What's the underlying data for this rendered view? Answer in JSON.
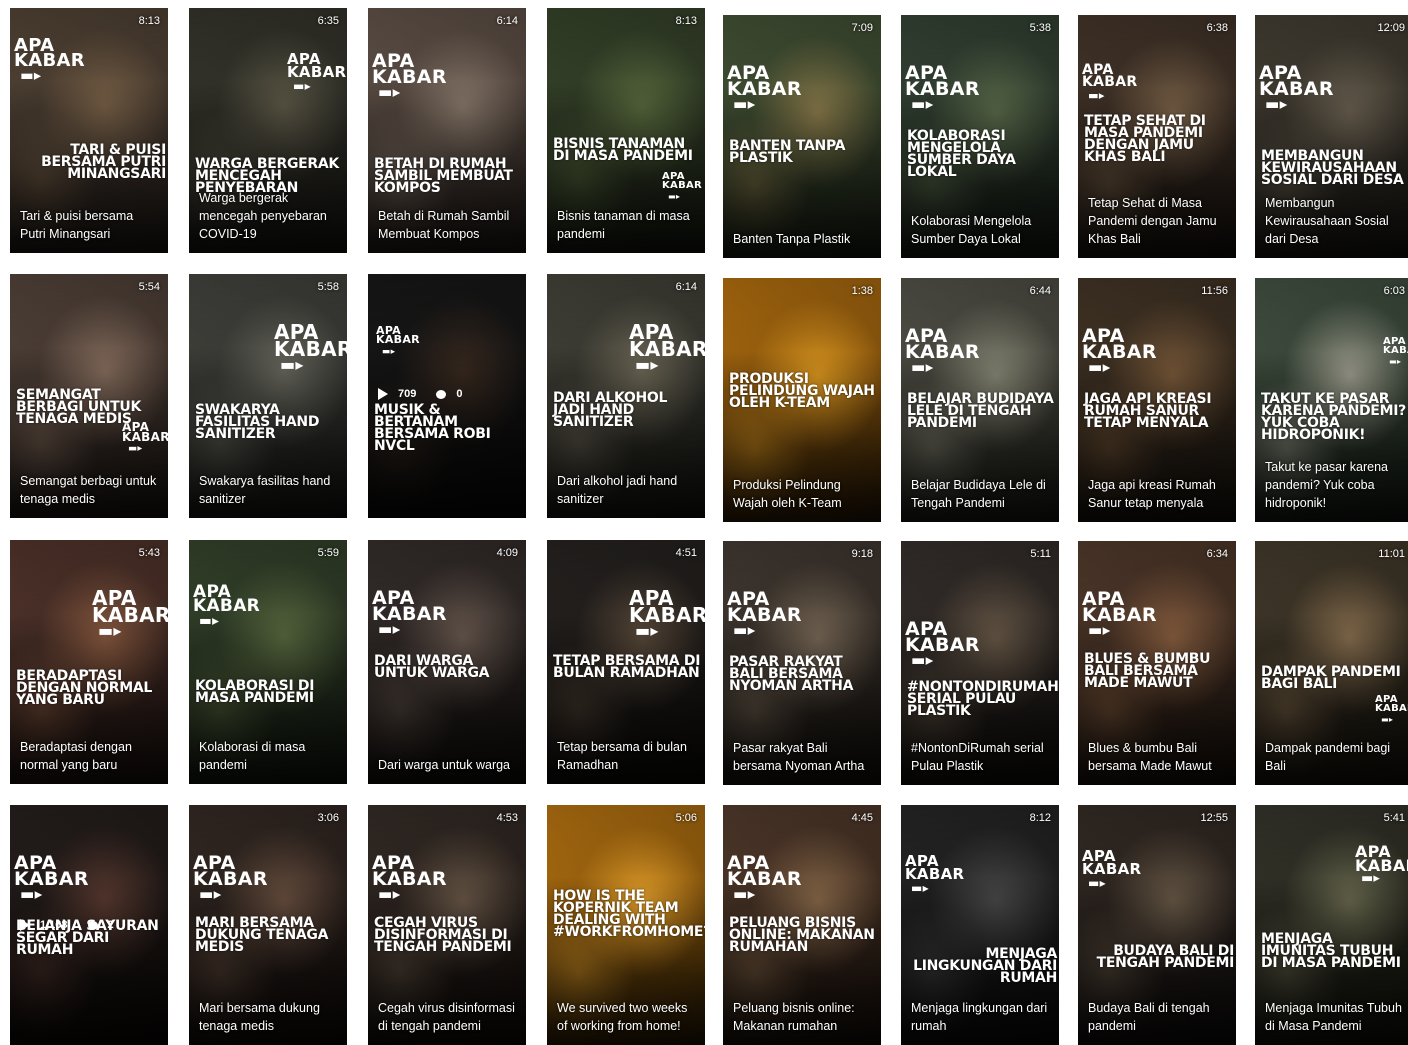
{
  "brand_logo": "APA KABAR",
  "brand_colors": {
    "orange": "#d88a10",
    "dark": "#1c1a18"
  },
  "videos": [
    {
      "duration": "8:13",
      "headline": "TARI & PUISI BERSAMA PUTRI MINANGSARI",
      "caption": "Tari & puisi bersama Putri Minangsari"
    },
    {
      "duration": "6:35",
      "headline": "WARGA BERGERAK MENCEGAH PENYEBARAN",
      "caption": "Warga bergerak mencegah penyebaran COVID-19"
    },
    {
      "duration": "6:14",
      "headline": "BETAH DI RUMAH SAMBIL MEMBUAT KOMPOS",
      "caption": "Betah di Rumah Sambil Membuat Kompos"
    },
    {
      "duration": "8:13",
      "headline": "BISNIS TANAMAN DI MASA PANDEMI",
      "caption": "Bisnis tanaman di masa pandemi"
    },
    {
      "duration": "7:09",
      "headline": "BANTEN TANPA PLASTIK",
      "caption": "Banten Tanpa Plastik"
    },
    {
      "duration": "5:38",
      "headline": "KOLABORASI MENGELOLA SUMBER DAYA LOKAL",
      "caption": "Kolaborasi Mengelola Sumber Daya Lokal"
    },
    {
      "duration": "6:38",
      "headline": "TETAP SEHAT DI MASA PANDEMI DENGAN JAMU KHAS BALI",
      "caption": "Tetap Sehat di Masa Pandemi dengan Jamu Khas Bali"
    },
    {
      "duration": "12:09",
      "headline": "MEMBANGUN KEWIRAUSAHAAN SOSIAL DARI DESA",
      "caption": "Membangun Kewirausahaan Sosial dari Desa"
    },
    {
      "duration": "5:54",
      "headline": "SEMANGAT BERBAGI UNTUK TENAGA MEDIS",
      "caption": "Semangat berbagi untuk tenaga medis"
    },
    {
      "duration": "5:58",
      "headline": "SWAKARYA FASILITAS HAND SANITIZER",
      "caption": "Swakarya fasilitas hand sanitizer"
    },
    {
      "duration": "",
      "headline": "MUSIK & BERTANAM BERSAMA ROBI NVCL",
      "caption": "",
      "views": "709",
      "comments": "0"
    },
    {
      "duration": "6:14",
      "headline": "DARI ALKOHOL JADI HAND SANITIZER",
      "caption": "Dari alkohol jadi hand sanitizer"
    },
    {
      "duration": "1:38",
      "headline": "PRODUKSI PELINDUNG WAJAH OLEH K-TEAM",
      "caption": "Produksi Pelindung Wajah oleh K-Team"
    },
    {
      "duration": "6:44",
      "headline": "BELAJAR BUDIDAYA LELE DI TENGAH PANDEMI",
      "caption": "Belajar Budidaya Lele di Tengah Pandemi"
    },
    {
      "duration": "11:56",
      "headline": "JAGA API KREASI RUMAH SANUR TETAP MENYALA",
      "caption": "Jaga api kreasi Rumah Sanur tetap menyala"
    },
    {
      "duration": "6:03",
      "headline": "TAKUT KE PASAR KARENA PANDEMI? YUK COBA HIDROPONIK!",
      "caption": "Takut ke pasar karena pandemi? Yuk coba hidroponik!"
    },
    {
      "duration": "5:43",
      "headline": "BERADAPTASI DENGAN NORMAL YANG BARU",
      "caption": "Beradaptasi dengan normal yang baru"
    },
    {
      "duration": "5:59",
      "headline": "KOLABORASI DI MASA PANDEMI",
      "caption": "Kolaborasi di masa pandemi"
    },
    {
      "duration": "4:09",
      "headline": "DARI WARGA UNTUK WARGA",
      "caption": "Dari warga untuk warga"
    },
    {
      "duration": "4:51",
      "headline": "TETAP BERSAMA DI BULAN RAMADHAN",
      "caption": "Tetap bersama di bulan Ramadhan"
    },
    {
      "duration": "9:18",
      "headline": "PASAR RAKYAT BALI BERSAMA NYOMAN ARTHA",
      "caption": "Pasar rakyat Bali bersama Nyoman Artha"
    },
    {
      "duration": "5:11",
      "headline": "#NONTONDIRUMAH SERIAL PULAU PLASTIK",
      "caption": "#NontonDiRumah serial Pulau Plastik"
    },
    {
      "duration": "6:34",
      "headline": "BLUES & BUMBU BALI BERSAMA MADE MAWUT",
      "caption": "Blues & bumbu Bali bersama Made Mawut"
    },
    {
      "duration": "11:01",
      "headline": "DAMPAK PANDEMI BAGI BALI",
      "caption": "Dampak pandemi bagi Bali"
    },
    {
      "duration": "",
      "headline": "BELANJA SAYURAN SEGAR DARI RUMAH",
      "caption": "",
      "views": "1,168",
      "comments": "2"
    },
    {
      "duration": "3:06",
      "headline": "MARI BERSAMA DUKUNG TENAGA MEDIS",
      "caption": "Mari bersama dukung tenaga medis"
    },
    {
      "duration": "4:53",
      "headline": "CEGAH VIRUS DISINFORMASI DI TENGAH PANDEMI",
      "caption": "Cegah virus disinformasi di tengah pandemi"
    },
    {
      "duration": "5:06",
      "headline": "HOW IS THE KOPERNIK TEAM DEALING WITH #WORKFROMHOME?",
      "caption": "We survived two weeks of working from home!"
    },
    {
      "duration": "4:45",
      "headline": "PELUANG BISNIS ONLINE: MAKANAN RUMAHAN",
      "caption": "Peluang bisnis online: Makanan rumahan"
    },
    {
      "duration": "8:12",
      "headline": "MENJAGA LINGKUNGAN DARI RUMAH",
      "caption": "Menjaga lingkungan dari rumah"
    },
    {
      "duration": "12:55",
      "headline": "BUDAYA BALI DI TENGAH PANDEMI",
      "caption": "Budaya Bali di tengah pandemi"
    },
    {
      "duration": "5:41",
      "headline": "MENJAGA IMUNITAS TUBUH DI MASA PANDEMI",
      "caption": "Menjaga Imunitas Tubuh di Masa Pandemi"
    }
  ]
}
